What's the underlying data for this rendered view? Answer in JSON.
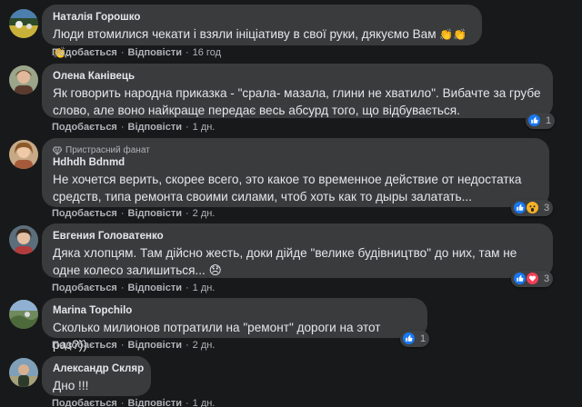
{
  "action_labels": {
    "like": "Подобається",
    "reply": "Відповісти"
  },
  "comments": [
    {
      "author": "Наталія Горошко",
      "badge": "",
      "text": "Люди втомилися чекати і взяли ініціативу в свої руки, дякуємо Вам",
      "emoji": "👏👏👏.",
      "time": "16 год",
      "reactions": [],
      "reaction_count": ""
    },
    {
      "author": "Олена Канівець",
      "badge": "",
      "text": "Як говорить народна приказка - \"срала- мазала, глини не хватило\". Вибачте за грубе слово, але воно найкраще передає весь абсурд того, що відбувається.",
      "emoji": "",
      "time": "1 дн.",
      "reactions": [
        "like"
      ],
      "reaction_count": "1"
    },
    {
      "author": "Hdhdh Bdnmd",
      "badge": "Пристрасний фанат",
      "text": "Не хочется верить, скорее всего, это какое то временное действие от недостатка средств, типа ремонта своими силами, чтоб хоть как то дыры залатать...",
      "emoji": "",
      "time": "2 дн.",
      "reactions": [
        "like",
        "wow"
      ],
      "reaction_count": "3"
    },
    {
      "author": "Евгения Головатенко",
      "badge": "",
      "text": "Дяка хлопцям. Там дійсно жесть, доки дійде \"велике будівництво\" до них, там не одне колесо залишиться...",
      "emoji": "😞",
      "time": "1 дн.",
      "reactions": [
        "like",
        "love"
      ],
      "reaction_count": "3"
    },
    {
      "author": "Marina Topchilo",
      "badge": "",
      "text": "Сколько милионов потратили на \"ремонт\" дороги на этот раз?))",
      "emoji": "",
      "time": "2 дн.",
      "reactions": [
        "like"
      ],
      "reaction_count": "1"
    },
    {
      "author": "Александр Скляр",
      "badge": "",
      "text": "Дно !!!",
      "emoji": "",
      "time": "1 дн.",
      "reactions": [],
      "reaction_count": ""
    }
  ]
}
